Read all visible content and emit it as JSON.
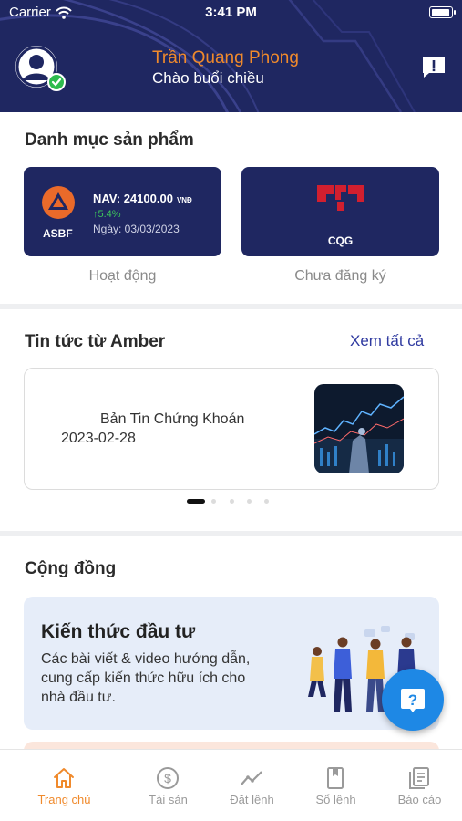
{
  "status_bar": {
    "carrier": "Carrier",
    "time": "3:41 PM",
    "wifi_icon": "wifi-icon",
    "battery_icon": "battery-icon"
  },
  "header": {
    "name": "Trần Quang Phong",
    "greeting": "Chào buổi chiều",
    "avatar_icon": "user-avatar-icon",
    "verified_icon": "check-badge-icon",
    "message_icon": "alert-message-icon",
    "colors": {
      "background": "#1f2761",
      "name": "#f08a2c"
    }
  },
  "products": {
    "title": "Danh mục sản phẩm",
    "items": [
      {
        "name": "ASBF",
        "nav_label": "NAV: 24100.00",
        "nav_unit": "VNĐ",
        "change": "↑5.4%",
        "date": "Ngày: 03/03/2023",
        "status": "Hoạt động"
      },
      {
        "name": "CQG",
        "status": "Chưa đăng ký"
      }
    ]
  },
  "news": {
    "title": "Tin tức từ Amber",
    "see_all": "Xem tất cả",
    "items": [
      {
        "title": "Bản Tin Chứng Khoán",
        "date": "2023-02-28"
      }
    ],
    "carousel": {
      "page_count": 5,
      "active_index": 0
    }
  },
  "community": {
    "title": "Cộng đồng",
    "card": {
      "title": "Kiến thức đầu tư",
      "description": "Các bài viết & video hướng dẫn, cung cấp kiến thức hữu ích cho nhà đầu tư."
    }
  },
  "fab": {
    "icon": "help-question-icon"
  },
  "bottom_nav": {
    "active": 0,
    "items": [
      {
        "label": "Trang chủ",
        "icon": "home-icon"
      },
      {
        "label": "Tài sản",
        "icon": "dollar-circle-icon"
      },
      {
        "label": "Đặt lệnh",
        "icon": "chart-line-icon"
      },
      {
        "label": "Sổ lệnh",
        "icon": "book-icon"
      },
      {
        "label": "Báo cáo",
        "icon": "report-icon"
      }
    ],
    "colors": {
      "active": "#f08a2c",
      "inactive": "#9a9a9a"
    }
  }
}
